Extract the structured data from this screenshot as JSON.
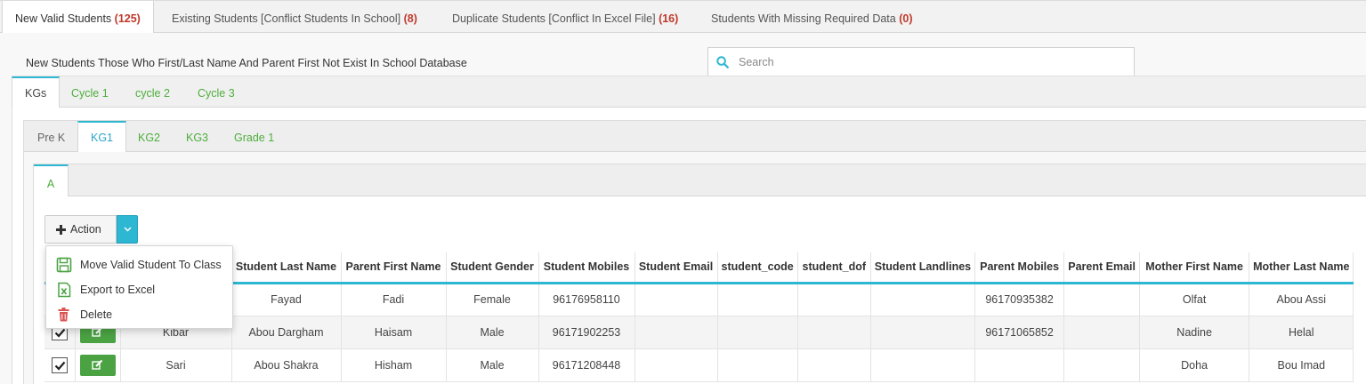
{
  "top_tabs": [
    {
      "label": "New Valid Students",
      "count": "(125)"
    },
    {
      "label": "Existing Students [Conflict Students In School]",
      "count": "(8)"
    },
    {
      "label": "Duplicate Students [Conflict In Excel File]",
      "count": "(16)"
    },
    {
      "label": "Students With Missing Required Data",
      "count": "(0)"
    }
  ],
  "heading": "New Students Those Who First/Last Name And Parent First Not Exist In School Database",
  "search": {
    "placeholder": "Search",
    "value": ""
  },
  "level_tabs": [
    {
      "label": "KGs"
    },
    {
      "label": "Cycle 1"
    },
    {
      "label": "cycle 2"
    },
    {
      "label": "Cycle 3"
    }
  ],
  "grade_tabs": [
    {
      "label": "Pre K"
    },
    {
      "label": "KG1"
    },
    {
      "label": "KG2"
    },
    {
      "label": "KG3"
    },
    {
      "label": "Grade 1"
    }
  ],
  "section_tabs": [
    {
      "label": "A"
    }
  ],
  "action_button": {
    "label": "Action"
  },
  "action_menu": [
    {
      "label": "Move Valid Student To Class",
      "icon": "save-icon"
    },
    {
      "label": "Export to Excel",
      "icon": "excel-icon"
    },
    {
      "label": "Delete",
      "icon": "trash-icon"
    }
  ],
  "table": {
    "columns": [
      "",
      "",
      "",
      "Student Last Name",
      "Parent First Name",
      "Student Gender",
      "Student Mobiles",
      "Student Email",
      "student_code",
      "student_dof",
      "Student Landlines",
      "Parent Mobiles",
      "Parent Email",
      "Mother First Name",
      "Mother Last Name"
    ],
    "rows": [
      {
        "first": "",
        "last": "Fayad",
        "parent_first": "Fadi",
        "gender": "Female",
        "mobiles": "96176958110",
        "email": "",
        "code": "",
        "dof": "",
        "landlines": "",
        "parent_mobiles": "96170935382",
        "parent_email": "",
        "mother_first": "Olfat",
        "mother_last": "Abou Assi"
      },
      {
        "first": "Kibar",
        "last": "Abou Dargham",
        "parent_first": "Haisam",
        "gender": "Male",
        "mobiles": "96171902253",
        "email": "",
        "code": "",
        "dof": "",
        "landlines": "",
        "parent_mobiles": "96171065852",
        "parent_email": "",
        "mother_first": "Nadine",
        "mother_last": "Helal"
      },
      {
        "first": "Sari",
        "last": "Abou Shakra",
        "parent_first": "Hisham",
        "gender": "Male",
        "mobiles": "96171208448",
        "email": "",
        "code": "",
        "dof": "",
        "landlines": "",
        "parent_mobiles": "",
        "parent_email": "",
        "mother_first": "Doha",
        "mother_last": "Bou Imad"
      }
    ]
  },
  "colors": {
    "accent": "#2eb7d2",
    "green": "#4aa243",
    "count_red": "#c0392b"
  }
}
